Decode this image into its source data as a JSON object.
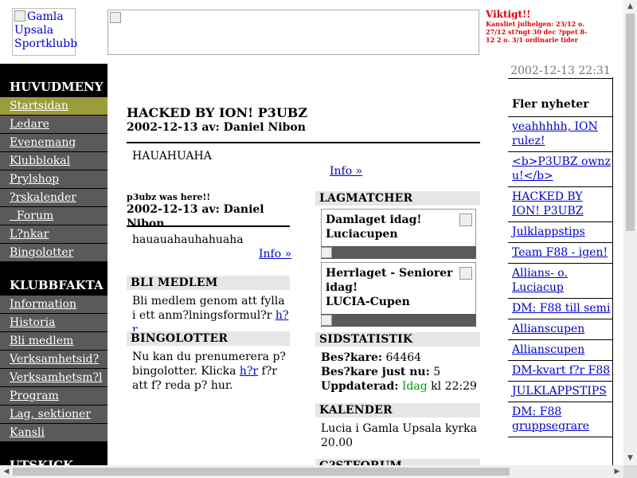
{
  "header": {
    "logo_alt": "Gamla Upsala Sportklubb",
    "notice": {
      "title": "Viktigt!!",
      "text": "Kansliet julhelgen: 23/12 o. 27/12 st?ngt 30 dec ?ppet 8-12 2 o. 3/1 ordinarie tider"
    }
  },
  "left_menu": {
    "main_heading": "HUVUDMENY",
    "main_items": [
      "Startsidan",
      "Ledare",
      "Evenemang",
      "Klubblokal",
      "Prylshop",
      "?rskalender",
      "  Forum",
      "L?nkar",
      "Bingolotter"
    ],
    "facts_heading": "KLUBBFAKTA",
    "facts_items": [
      "Information",
      "Historia",
      "Bli medlem",
      "Verksamhetsid?",
      "Verksamhetsm?l",
      "Program",
      "Lag, sektioner",
      "Kansli"
    ],
    "next_heading": "UTSKICK"
  },
  "main": {
    "post1": {
      "title": "HACKED BY ION! P3UBZ",
      "byline": "2002-12-13 av: Daniel Nibon",
      "body": "HAUAHUAHA",
      "info": "Info »"
    },
    "post2": {
      "title": "p3ubz was here!!",
      "byline": "2002-12-13 av: Daniel Nibon",
      "body": "hauauahauhahuaha",
      "info": "Info »"
    },
    "bli_medlem": {
      "heading": "BLI MEDLEM",
      "text": "Bli medlem genom att fylla i ett anm?lningsformul?r ",
      "link": "h?r",
      "end": "."
    },
    "bingolotter": {
      "heading": "BINGOLOTTER",
      "text": "Nu kan du prenumerera p? bingolotter. Klicka ",
      "link": "h?r",
      "end": " f?r att f? reda p? hur."
    },
    "lagmatcher": {
      "heading": "LAGMATCHER",
      "matches": [
        {
          "line1": "Damlaget idag!",
          "line2": "Luciacupen"
        },
        {
          "line1": "Herrlaget - Seniorer idag!",
          "line2": "LUCIA-Cupen"
        }
      ]
    },
    "sidstatistik": {
      "heading": "SIDSTATISTIK",
      "visitors_label": "Bes?kare:",
      "visitors": "64464",
      "now_label": "Bes?kare just nu:",
      "now": "5",
      "updated_label": "Uppdaterad:",
      "updated_day": "Idag",
      "updated_time": "kl 22:29"
    },
    "kalender": {
      "heading": "KALENDER",
      "text": "Lucia i Gamla Upsala kyrka 20.00"
    },
    "gastforum": {
      "heading": "G?STFORUM"
    }
  },
  "right": {
    "datetime": "2002-12-13 22:31",
    "heading": "Fler nyheter",
    "items": [
      "yeahhhhh, ION rulez!",
      "<b>P3UBZ ownz u!</b>",
      "HACKED BY ION! P3UBZ",
      "Julklappstips",
      "Team F88 - igen!",
      "Allians- o. Luciacup",
      "DM: F88 till semi",
      "Allianscupen",
      "Allianscupen",
      "DM-kvart f?r F88",
      "JULKLAPPSTIPS",
      "DM: F88 gruppsegrare"
    ]
  }
}
